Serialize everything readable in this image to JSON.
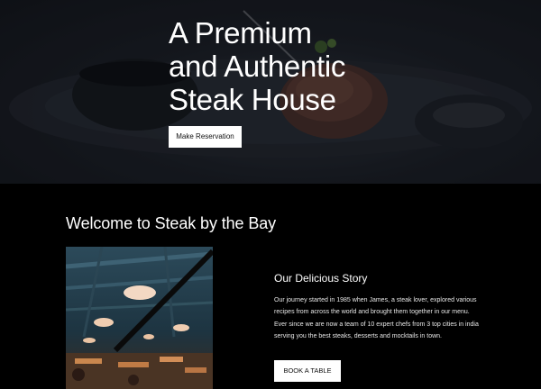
{
  "hero": {
    "title_line1": "A Premium",
    "title_line2": "and Authentic",
    "title_line3": "Steak House",
    "button_label": "Make Reservation"
  },
  "welcome": {
    "title": "Welcome to Steak by the Bay"
  },
  "story": {
    "title": "Our Delicious Story",
    "body": "Our journey started in 1985 when James, a steak lover, explored various recipes from across the world and brought them together in our menu. Ever since we are now a team of 10 expert chefs from 3 top cities in india serving you the best steaks, desserts and mocktails in town.",
    "button_label": "BOOK A TABLE"
  },
  "colors": {
    "page_background": "#000000",
    "button_background": "#ffffff",
    "button_text": "#111111"
  }
}
